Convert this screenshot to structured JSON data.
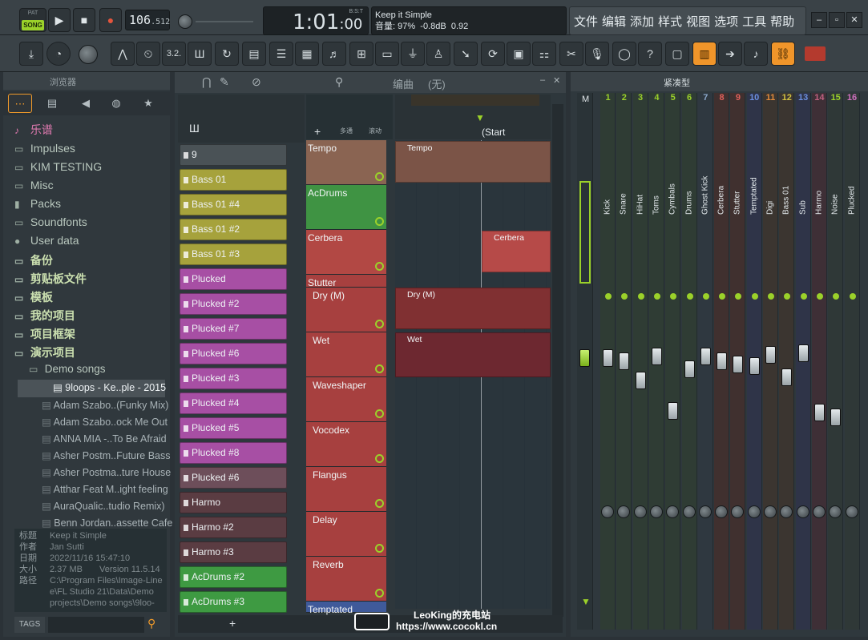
{
  "transport": {
    "pat_label": "PAT",
    "song_label": "SONG",
    "tempo_main": "106",
    "tempo_frac": ".512",
    "time": "1:01",
    "time_frac": ":00",
    "bst_label": "B:S:T"
  },
  "song_info": {
    "title": "Keep it Simple",
    "volume_label": "音量:",
    "volume": "97%",
    "db": "-0.8dB",
    "value": "0.92"
  },
  "menu": [
    "文件",
    "编辑",
    "添加",
    "样式",
    "视图",
    "选项",
    "工具",
    "帮助"
  ],
  "window": {
    "min": "–",
    "max": "▫",
    "close": "✕"
  },
  "browser": {
    "title": "浏览器",
    "folders": [
      {
        "label": "乐谱",
        "style": "pink"
      },
      {
        "label": "Impulses"
      },
      {
        "label": "KIM TESTING"
      },
      {
        "label": "Misc"
      },
      {
        "label": "Packs"
      },
      {
        "label": "Soundfonts"
      },
      {
        "label": "User data"
      },
      {
        "label": "备份",
        "style": "cn"
      },
      {
        "label": "剪贴板文件",
        "style": "cn"
      },
      {
        "label": "模板",
        "style": "cn"
      },
      {
        "label": "我的项目",
        "style": "cn"
      },
      {
        "label": "项目框架",
        "style": "cn"
      },
      {
        "label": "演示项目",
        "style": "cn"
      }
    ],
    "subfolder": "Demo songs",
    "selected_file": "9loops - Ke..ple - 2015",
    "files": [
      "Adam Szabo..(Funky Mix)",
      "Adam Szabo..ock Me Out",
      "ANNA MIA -..To Be Afraid",
      "Asher Postm..Future Bass",
      "Asher Postma..ture House",
      "Atthar Feat M..ight feeling",
      "AuraQualic..tudio Remix)",
      "Benn Jordan..assette Cafe"
    ],
    "info": {
      "title_k": "标题",
      "title_v": "Keep it Simple",
      "author_k": "作者",
      "author_v": "Jan Sutti",
      "date_k": "日期",
      "date_v": "2022/11/16 15:47:10",
      "size_k": "大小",
      "size_v": "2.37 MB",
      "version_v": "Version 11.5.14",
      "path_k": "路径",
      "path_v1": "C:\\Program Files\\Image-Line",
      "path_v2": "e\\FL Studio 21\\Data\\Demo",
      "path_v3": "projects\\Demo songs\\9loo-"
    },
    "tags": "TAGS"
  },
  "playlist": {
    "title": "编曲",
    "none": "(无)",
    "start_marker": "Start",
    "patterns": [
      {
        "label": "9",
        "color": "#4a5256"
      },
      {
        "label": "Bass 01",
        "color": "#a6a23c"
      },
      {
        "label": "Bass 01 #4",
        "color": "#a6a23c"
      },
      {
        "label": "Bass 01 #2",
        "color": "#a6a23c"
      },
      {
        "label": "Bass 01 #3",
        "color": "#a6a23c"
      },
      {
        "label": "Plucked",
        "color": "#a74fa4"
      },
      {
        "label": "Plucked #2",
        "color": "#a74fa4"
      },
      {
        "label": "Plucked #7",
        "color": "#a74fa4"
      },
      {
        "label": "Plucked #6",
        "color": "#a74fa4"
      },
      {
        "label": "Plucked #3",
        "color": "#a74fa4"
      },
      {
        "label": "Plucked #4",
        "color": "#a74fa4"
      },
      {
        "label": "Plucked #5",
        "color": "#a74fa4"
      },
      {
        "label": "Plucked #8",
        "color": "#a74fa4"
      },
      {
        "label": "Plucked #6",
        "color": "#6d4e5a"
      },
      {
        "label": "Harmo",
        "color": "#5a3c42"
      },
      {
        "label": "Harmo #2",
        "color": "#5a3c42"
      },
      {
        "label": "Harmo #3",
        "color": "#5a3c42"
      },
      {
        "label": "AcDrums #2",
        "color": "#3e9a42"
      },
      {
        "label": "AcDrums #3",
        "color": "#3e9a42"
      }
    ],
    "tracks": [
      {
        "label": "Tempo",
        "color": "#8a6452"
      },
      {
        "label": "AcDrums",
        "color": "#3f9343"
      },
      {
        "label": "Cerbera",
        "color": "#b24844"
      },
      {
        "label": "Stutter",
        "color": "#a7403f"
      },
      {
        "label": "Dry (M)",
        "color": "#a7403f"
      },
      {
        "label": "Wet",
        "color": "#a7403f"
      },
      {
        "label": "Waveshaper",
        "color": "#a7403f"
      },
      {
        "label": "Vocodex",
        "color": "#a7403f"
      },
      {
        "label": "Flangus",
        "color": "#a7403f"
      },
      {
        "label": "Delay",
        "color": "#a7403f"
      },
      {
        "label": "Reverb",
        "color": "#a7403f"
      },
      {
        "label": "Temptated",
        "color": "#3f5a9a"
      }
    ],
    "clips": [
      {
        "label": "Tempo"
      },
      {
        "label": "Cerbera"
      },
      {
        "label": "Dry (M)"
      },
      {
        "label": "Wet"
      }
    ],
    "mode_labels": [
      "多通",
      "滚动"
    ]
  },
  "mixer": {
    "title": "紧凑型",
    "master_label": "M",
    "strips": [
      {
        "num": "1",
        "name": "Kick",
        "color": "#9bd12a"
      },
      {
        "num": "2",
        "name": "Snare",
        "color": "#9bd12a"
      },
      {
        "num": "3",
        "name": "HiHat",
        "color": "#9bd12a"
      },
      {
        "num": "4",
        "name": "Toms",
        "color": "#9bd12a"
      },
      {
        "num": "5",
        "name": "Cymbals",
        "color": "#9bd12a"
      },
      {
        "num": "6",
        "name": "Drums",
        "color": "#9bd12a"
      },
      {
        "num": "7",
        "name": "Ghost Kick",
        "color": "#8aa6c8"
      },
      {
        "num": "8",
        "name": "Cerbera",
        "color": "#e0605a"
      },
      {
        "num": "9",
        "name": "Stutter",
        "color": "#e0605a"
      },
      {
        "num": "10",
        "name": "Temptated",
        "color": "#6b8fe0"
      },
      {
        "num": "11",
        "name": "Digi",
        "color": "#e08a3a"
      },
      {
        "num": "12",
        "name": "Bass 01",
        "color": "#d0c040"
      },
      {
        "num": "13",
        "name": "Sub",
        "color": "#6b8fe0"
      },
      {
        "num": "14",
        "name": "Harmo",
        "color": "#c06080"
      },
      {
        "num": "15",
        "name": "Noise",
        "color": "#9bd12a"
      },
      {
        "num": "16",
        "name": "Plucked",
        "color": "#d070c0"
      }
    ]
  },
  "watermark": {
    "line1": "LeoKing的充电站",
    "line2": "https://www.cocokl.cn"
  }
}
